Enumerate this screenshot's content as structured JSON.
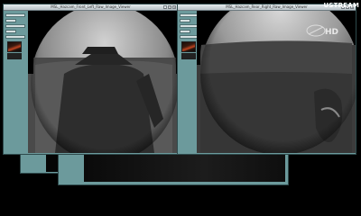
{
  "windows": {
    "back_left": {
      "title": ""
    },
    "back_right": {
      "title": ""
    },
    "left": {
      "title": "MSL_Hazcam_Front_Left_Raw_Image_Viewer",
      "controls": [
        "_",
        "□",
        "×"
      ]
    },
    "right": {
      "title": "MSL_Hazcam_Rear_Right_Raw_Image_Viewer",
      "controls": [
        "_",
        "□",
        "×"
      ]
    }
  },
  "watermark": "USTREAM",
  "hd_badge": "HD",
  "colors": {
    "panel": "#6c9a9c",
    "desktop": "#000000"
  },
  "icons": [
    "minimize-icon",
    "maximize-icon",
    "close-icon",
    "hd-badge-icon",
    "thumbnail-icon"
  ]
}
